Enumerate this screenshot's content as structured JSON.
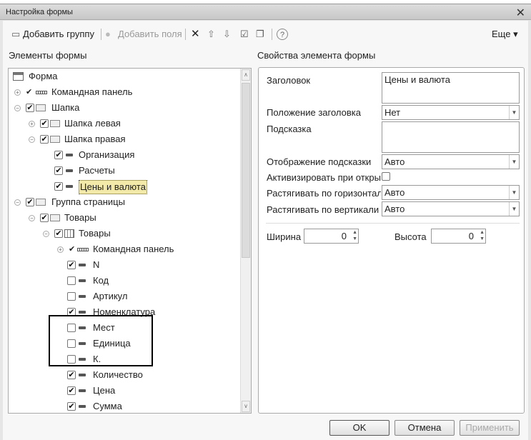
{
  "window": {
    "title": "Настройка формы",
    "close": "✕"
  },
  "toolbar": {
    "add_group": "Добавить группу",
    "add_fields": "Добавить поля",
    "more": "Еще ▾",
    "help": "?"
  },
  "left": {
    "heading": "Элементы формы"
  },
  "right": {
    "heading": "Свойства элемента формы"
  },
  "tree": [
    {
      "label": "Форма",
      "level": "root",
      "icon": "form-icon"
    },
    {
      "label": "Командная панель",
      "expander": "+",
      "check": "tick",
      "icon": "command-bar-icon"
    },
    {
      "label": "Шапка",
      "expander": "−",
      "check": true,
      "icon": "folder-icon"
    },
    {
      "label": "Шапка левая",
      "expander": "+",
      "check": true,
      "icon": "folder-icon"
    },
    {
      "label": "Шапка правая",
      "expander": "−",
      "check": true,
      "icon": "folder-icon"
    },
    {
      "label": "Организация",
      "check": true,
      "icon": "field-icon"
    },
    {
      "label": "Расчеты",
      "check": true,
      "icon": "field-icon"
    },
    {
      "label": "Цены и валюта",
      "check": true,
      "icon": "field-icon",
      "selected": true
    },
    {
      "label": "Группа страницы",
      "expander": "−",
      "check": true,
      "icon": "folder-icon"
    },
    {
      "label": "Товары",
      "expander": "−",
      "check": true,
      "icon": "folder-icon"
    },
    {
      "label": "Товары",
      "expander": "−",
      "check": true,
      "icon": "table-icon"
    },
    {
      "label": "Командная панель",
      "expander": "+",
      "check": "tick",
      "icon": "command-bar-icon"
    },
    {
      "label": "N",
      "check": true,
      "icon": "field-icon"
    },
    {
      "label": "Код",
      "check": false,
      "icon": "field-icon"
    },
    {
      "label": "Артикул",
      "check": false,
      "icon": "field-icon"
    },
    {
      "label": "Номенклатура",
      "check": true,
      "icon": "field-icon"
    },
    {
      "label": "Мест",
      "check": false,
      "icon": "field-icon"
    },
    {
      "label": "Единица",
      "check": false,
      "icon": "field-icon"
    },
    {
      "label": "К.",
      "check": false,
      "icon": "field-icon"
    },
    {
      "label": "Количество",
      "check": true,
      "icon": "field-icon"
    },
    {
      "label": "Цена",
      "check": true,
      "icon": "field-icon"
    },
    {
      "label": "Сумма",
      "check": true,
      "icon": "field-icon"
    }
  ],
  "props": {
    "title_label": "Заголовок",
    "title_value": "Цены и валюта",
    "title_pos_label": "Положение заголовка",
    "title_pos_value": "Нет",
    "hint_label": "Подсказка",
    "hint_value": "",
    "hint_display_label": "Отображение подсказки",
    "hint_display_value": "Авто",
    "activate_label": "Активизировать при откры",
    "activate_checked": false,
    "hstretch_label": "Растягивать по горизонтал",
    "hstretch_value": "Авто",
    "vstretch_label": "Растягивать по вертикали",
    "vstretch_value": "Авто",
    "width_label": "Ширина",
    "width_value": "0",
    "height_label": "Высота",
    "height_value": "0"
  },
  "buttons": {
    "ok": "OK",
    "cancel": "Отмена",
    "apply": "Применить"
  }
}
